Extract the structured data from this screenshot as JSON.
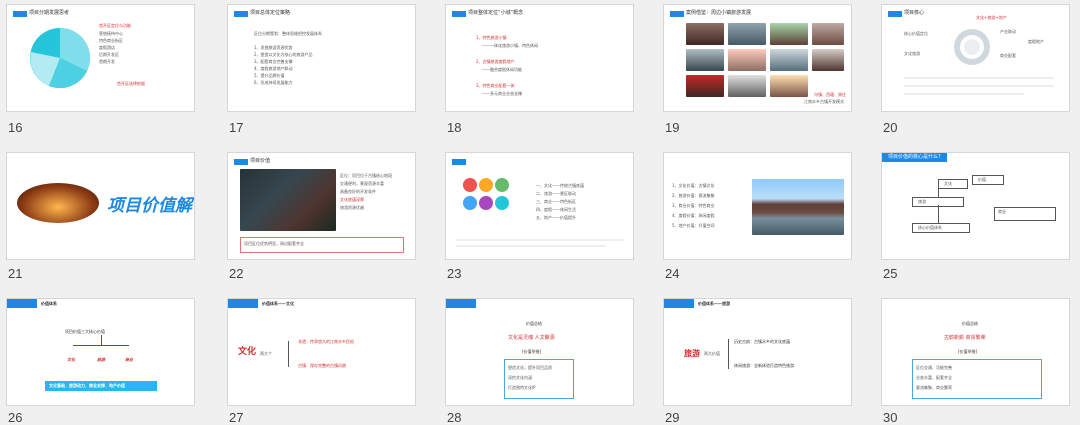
{
  "slides": [
    {
      "number": "16",
      "header": "项目分期发展思考",
      "lines": [
        "首开区定位与功能",
        "营销接待中心",
        "特色商业街区",
        "度假酒店",
        "后期开发区",
        "首期开发"
      ],
      "sub": "首开区选择依据"
    },
    {
      "number": "17",
      "header": "项目总体定位策略",
      "lines": [
        "区位分期策划：整体思维把控发展体系",
        "1、发掘旅游资源优势",
        "2、塑造以文化为核心的旅游产品",
        "3、配套商业完善支撑",
        "4、度假旅游地产联动",
        "5、提升品牌价值",
        "6、形成持续发展能力"
      ]
    },
    {
      "number": "18",
      "header": "项目整体定位“小城”概念",
      "lines": [
        "1、特色旅游小镇",
        "——一体化旅游小镇，特色休闲",
        "2、古镇旅游度假地产",
        "——融合度假休闲功能",
        "3、特色商业配套一体",
        "——多元商业业态支撑"
      ]
    },
    {
      "number": "19",
      "header": "案例借鉴：周边小镇旅游发展",
      "caption": "乌镇、西塘、周庄",
      "caption2": "江南水乡古镇开发模式"
    },
    {
      "number": "20",
      "header": "项目核心",
      "lines": [
        "文化+旅游+地产",
        "核心价值定位",
        "产业联动",
        "度假地产",
        "文化旅游",
        "商业配套"
      ]
    },
    {
      "number": "21",
      "title": "项目价值解读"
    },
    {
      "number": "22",
      "header": "项目价值",
      "lines": [
        "区位：项目位于古镇核心地段",
        "交通便利，景观资源丰富",
        "具备良好的开发条件",
        "文化底蕴深厚",
        "旅游资源优越"
      ],
      "note": "项目区位优势明显，周边配套齐全"
    },
    {
      "number": "23",
      "header": "项目价值",
      "lines": [
        "一、文化——传统古镇底蕴",
        "二、旅游——景区联动",
        "三、商业——特色街区",
        "四、度假——休闲生活",
        "五、地产——价值提升"
      ]
    },
    {
      "number": "24",
      "header": "",
      "lines": [
        "1、文化价值：古镇文化",
        "2、旅游价值：客流集聚",
        "3、商业价值：特色商业",
        "4、度假价值：休闲度假",
        "5、地产价值：升值空间"
      ]
    },
    {
      "number": "25",
      "header": "项目价值的核心是什么？",
      "lines": [
        "文化",
        "价值",
        "旅游",
        "商业",
        "核心价值体系"
      ]
    },
    {
      "number": "26",
      "header": "价值体系",
      "title": "项目价值三大核心价值",
      "items": [
        "文化",
        "旅游",
        "商业"
      ],
      "footer": "文化基础、旅游动力、商业支撑、地产价值"
    },
    {
      "number": "27",
      "header": "价值体系——文化",
      "left": "文化",
      "mid": "两大个",
      "items": [
        "非遗：传承悠久的江南水乡民俗",
        "古镇：保存完整的古镇风貌"
      ]
    },
    {
      "number": "28",
      "header": "价值总结",
      "title": "文化是灵魂 人文聚源",
      "sub": "[价值举措]",
      "lines": [
        "塑造文化，提升项目品质",
        "深挖文化内涵",
        "打造独特文化IP"
      ]
    },
    {
      "number": "29",
      "header": "价值体系——旅游",
      "left": "旅游",
      "mid": "两大价值",
      "items": [
        "历史古韵：古镇水乡的文化底蕴",
        "休闲旅游：全新体验打造特色旅游"
      ]
    },
    {
      "number": "30",
      "header": "价值总结",
      "title": "古韵新颜 商贸繁荣",
      "sub": "[价值举措]",
      "lines": [
        "区位交通、功能完善",
        "业态丰富、配套齐全",
        "客流集聚、商业繁荣"
      ]
    }
  ]
}
